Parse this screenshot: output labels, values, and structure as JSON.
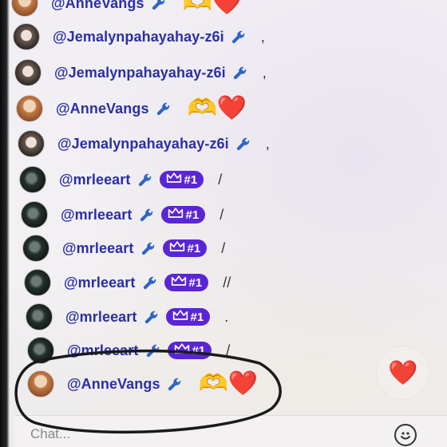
{
  "messages": [
    {
      "user": "@AnneVangs",
      "avatar": "anne",
      "badge": null,
      "text": "",
      "emoji": "🫶❤️"
    },
    {
      "user": "@Jemalynpahayahay-z6i",
      "avatar": "jem",
      "badge": null,
      "text": ",",
      "emoji": ""
    },
    {
      "user": "@Jemalynpahayahay-z6i",
      "avatar": "jem",
      "badge": null,
      "text": ",",
      "emoji": ""
    },
    {
      "user": "@AnneVangs",
      "avatar": "anne",
      "badge": null,
      "text": "",
      "emoji": "🫶❤️"
    },
    {
      "user": "@Jemalynpahayahay-z6i",
      "avatar": "jem",
      "badge": null,
      "text": ",",
      "emoji": ""
    },
    {
      "user": "@mrleeart",
      "avatar": "mrlee",
      "badge": "#1",
      "text": "/",
      "emoji": ""
    },
    {
      "user": "@mrleeart",
      "avatar": "mrlee",
      "badge": "#1",
      "text": "/",
      "emoji": ""
    },
    {
      "user": "@mrleeart",
      "avatar": "mrlee",
      "badge": "#1",
      "text": "/",
      "emoji": ""
    },
    {
      "user": "@mrleeart",
      "avatar": "mrlee",
      "badge": "#1",
      "text": "//",
      "emoji": ""
    },
    {
      "user": "@mrleeart",
      "avatar": "mrlee",
      "badge": "#1",
      "text": ".",
      "emoji": ""
    },
    {
      "user": "@mrleeart",
      "avatar": "mrlee",
      "badge": "#1",
      "text": "/",
      "emoji": ""
    },
    {
      "user": "@AnneVangs",
      "avatar": "anne",
      "badge": null,
      "text": "",
      "emoji": "🫶❤️"
    }
  ],
  "composer": {
    "placeholder": "Chat...",
    "heart_icon": "heart-icon",
    "emoji_icon": "smiley-face-icon"
  },
  "colors": {
    "username": "#2b2fa5",
    "badge_bg": "#5a25d6",
    "annotation_ink": "#1a1a1a",
    "heart": "#e1322a"
  }
}
